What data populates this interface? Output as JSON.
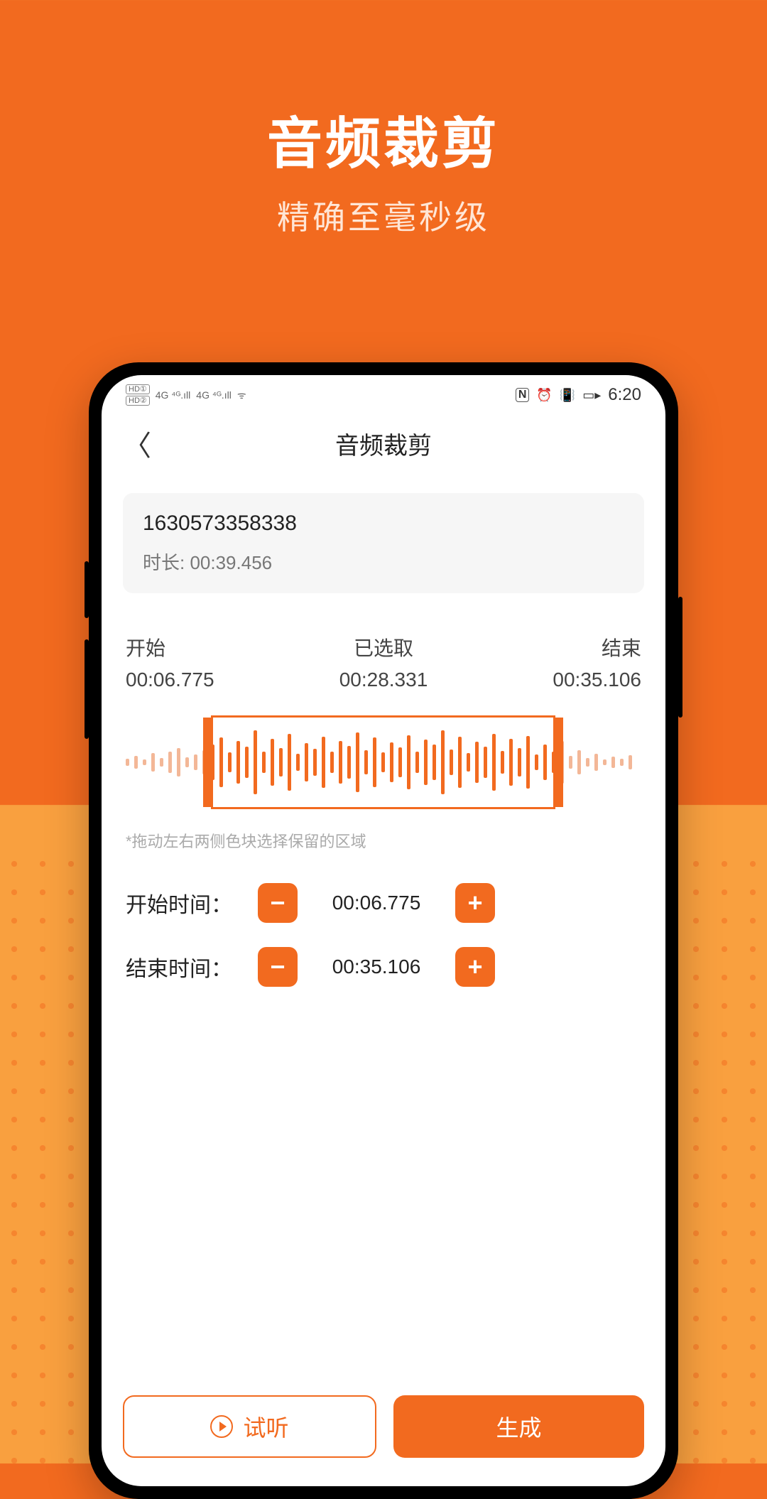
{
  "marketing": {
    "title": "音频裁剪",
    "subtitle": "精确至毫秒级"
  },
  "status": {
    "hd1": "HD①",
    "hd2": "HD②",
    "sig1": "4G ⁴ᴳ.ıll",
    "sig2": "4G ⁴ᴳ.ıll",
    "wifi": "ᯤ",
    "nfc": "N",
    "alarm": "⏰",
    "vib": "📳",
    "battery": "▭▸",
    "clock": "6:20"
  },
  "header": {
    "back": "〈",
    "title": "音频裁剪"
  },
  "file": {
    "name": "1630573358338",
    "duration_label": "时长: 00:39.456"
  },
  "timeline": {
    "start_label": "开始",
    "start_value": "00:06.775",
    "selected_label": "已选取",
    "selected_value": "00:28.331",
    "end_label": "结束",
    "end_value": "00:35.106"
  },
  "hint": "*拖动左右两侧色块选择保留的区域",
  "inputs": {
    "start_label": "开始时间：",
    "start_value": "00:06.775",
    "end_label": "结束时间：",
    "end_value": "00:35.106",
    "minus": "−",
    "plus": "+"
  },
  "actions": {
    "preview": "试听",
    "generate": "生成"
  },
  "waveform": {
    "bars": [
      10,
      18,
      8,
      26,
      12,
      30,
      40,
      14,
      22,
      34,
      50,
      70,
      28,
      60,
      44,
      90,
      30,
      66,
      40,
      80,
      24,
      54,
      38,
      72,
      30,
      60,
      46,
      84,
      34,
      70,
      28,
      56,
      42,
      76,
      30,
      64,
      50,
      90,
      36,
      72,
      26,
      58,
      44,
      80,
      32,
      66,
      40,
      74,
      22,
      50,
      30,
      60,
      18,
      34,
      12,
      24,
      8,
      16,
      10,
      20
    ],
    "sel_start_idx": 10,
    "sel_end_idx": 50
  }
}
